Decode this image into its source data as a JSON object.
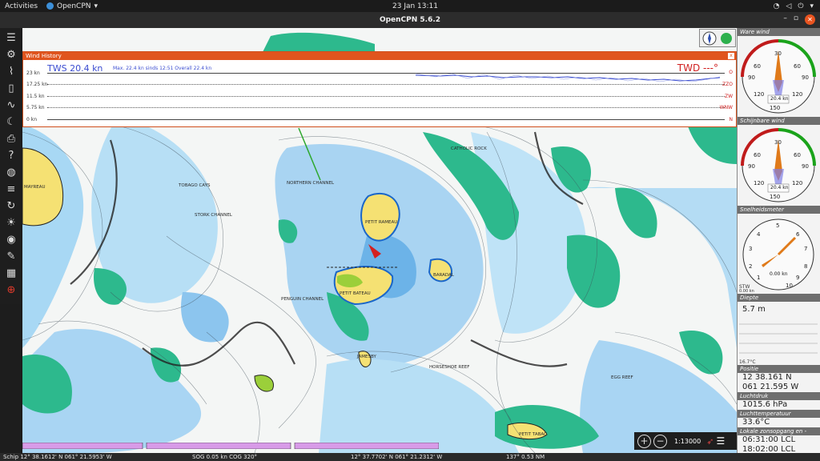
{
  "topbar": {
    "activities": "Activities",
    "app": "OpenCPN",
    "clock": "23 Jan 13:11"
  },
  "window": {
    "title": "OpenCPN 5.6.2"
  },
  "toolbar": [
    "menu-icon",
    "settings-icon",
    "route-icon",
    "layers-icon",
    "track-icon",
    "moon-icon",
    "print-icon",
    "help-icon",
    "globe-icon",
    "grid-icon",
    "rotate-icon",
    "sun-icon",
    "ais-icon",
    "tools-icon",
    "dashboard-icon",
    "lifebuoy-icon"
  ],
  "wind_history": {
    "title": "Wind History",
    "tws": "TWS 20.4 kn",
    "stats": "Max. 22.4 kn sinds 12:51  Overall 22.4 kn",
    "twd": "TWD ---°",
    "y_labels": [
      "23 kn",
      "17.25 kn",
      "11.5 kn",
      "5.75 kn",
      "0 kn"
    ],
    "dir_labels": [
      "O",
      "ZZO",
      "ZW",
      "WNW",
      "N"
    ]
  },
  "chart_labels": [
    "TOBAGO CAYS",
    "NORTHERN CHANNEL",
    "STORK CHANNEL",
    "PETIT RAMEAU",
    "PETIT BATEAU",
    "BARADAL",
    "JAMESBY",
    "PENGUIN CHANNEL",
    "HORSESHOE REEF",
    "EGG REEF",
    "PETIT TABAC",
    "MAYREAU",
    "CATHOLIC ROCK"
  ],
  "dashboard": {
    "wind_true": "Ware wind",
    "wind_true_value": "20.4 kn",
    "wind_app": "Schijnbare wind",
    "wind_app_value": "20.4 kn",
    "speed": "Snelheidsmeter",
    "speed_value": "0.00 kn",
    "stw": "STW",
    "stw_value": "0.00 kn",
    "depth": "Diepte",
    "depth_value": "5.7 m",
    "water_temp": "16.7°C",
    "position": "Positie",
    "lat": "12 38.161 N",
    "lon": "061 21.595 W",
    "pressure": "Luchtdruk",
    "pressure_value": "1015.6 hPa",
    "air_temp": "Luchttemperatuur",
    "air_temp_value": "33.6°C",
    "sun": "Lokale zonsopgang en -onde",
    "sunrise": "06:31:00 LCL",
    "sunset": "18:02:00 LCL"
  },
  "scale": "1:13000",
  "status": {
    "ship": "Schip 12° 38.1612' N   061° 21.5953' W",
    "sog": "SOG 0.05 kn  COG 320°",
    "cursor": "12° 37.7702' N   061° 21.2312' W",
    "brg": "137°  0.53 NM"
  }
}
